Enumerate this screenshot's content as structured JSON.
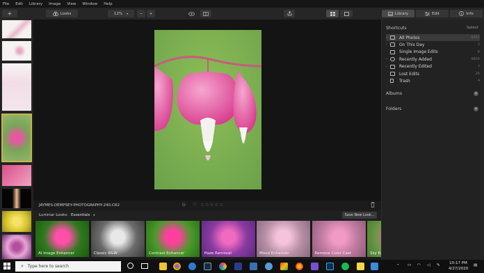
{
  "menu": [
    "File",
    "Edit",
    "Library",
    "Image",
    "View",
    "Window",
    "Help"
  ],
  "toolbar": {
    "add_label": "+",
    "looks_label": "Looks",
    "zoom_value": "12%",
    "zoom_out": "−",
    "zoom_in": "+",
    "tabs": {
      "library": "Library",
      "edit": "Edit",
      "info": "Info"
    }
  },
  "viewer": {
    "filename": "JAYMES-DEMPSEY-PHOTOGRAPHY-240.CR2",
    "rating_stars": 0,
    "flag_label": "G·"
  },
  "looks_bar": {
    "label": "Luminar Looks:",
    "category": "Essentials",
    "save_button": "Save New Look..."
  },
  "looks": [
    {
      "name": "AI Image Enhancer",
      "style": "vivid"
    },
    {
      "name": "Classic B&W",
      "style": "bw"
    },
    {
      "name": "Contrast Enhancer",
      "style": "contrast"
    },
    {
      "name": "Haze Removal",
      "style": "haze"
    },
    {
      "name": "Mood Enhancer",
      "style": "mood"
    },
    {
      "name": "Remove Color Cast",
      "style": "cast"
    },
    {
      "name": "Sky Enhancer",
      "style": "sky"
    }
  ],
  "sidebar": {
    "shortcuts_title": "Shortcuts",
    "select_label": "Select",
    "items": [
      {
        "label": "All Photos",
        "count": "9052",
        "icon": "photos-icon",
        "selected": true,
        "expandable": true
      },
      {
        "label": "On This Day",
        "count": "2",
        "icon": "calendar-icon",
        "selected": false,
        "expandable": true
      },
      {
        "label": "Single Image Edits",
        "count": "8",
        "icon": "image-icon",
        "selected": false,
        "expandable": false
      },
      {
        "label": "Recently Added",
        "count": "4804",
        "icon": "plus-circle-icon",
        "selected": false,
        "expandable": true
      },
      {
        "label": "Recently Edited",
        "count": "7",
        "icon": "edit-icon",
        "selected": false,
        "expandable": true
      },
      {
        "label": "Lost Edits",
        "count": "25",
        "icon": "lost-icon",
        "selected": false,
        "expandable": false
      },
      {
        "label": "Trash",
        "count": "4",
        "icon": "trash-icon",
        "selected": false,
        "expandable": false
      }
    ],
    "albums_title": "Albums",
    "folders_title": "Folders"
  },
  "taskbar": {
    "search_placeholder": "Type here to search",
    "time": "10:17 PM",
    "date": "4/27/2020"
  },
  "colors": {
    "accent_select": "#c9b34a",
    "panel": "#222222",
    "viewer_bg": "#141414",
    "pink": "#e45aa0"
  }
}
